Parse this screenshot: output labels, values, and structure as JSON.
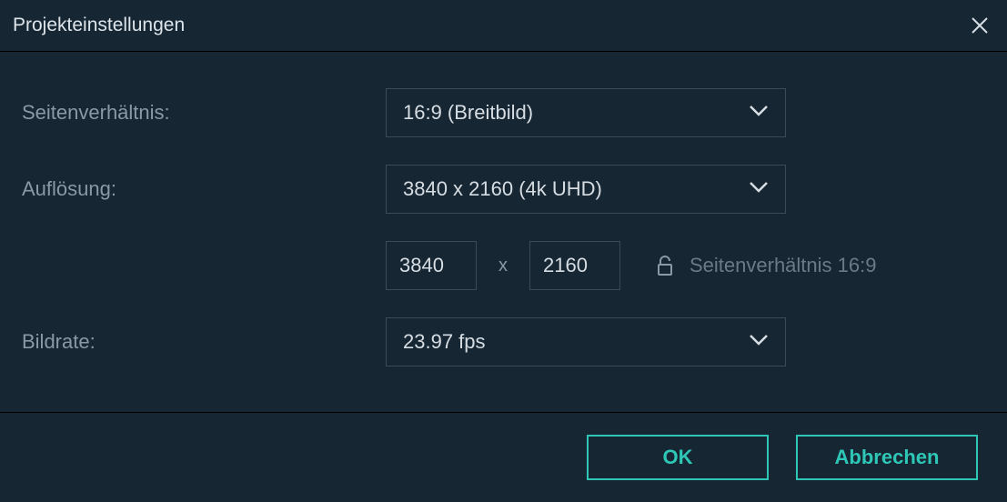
{
  "header": {
    "title": "Projekteinstellungen"
  },
  "form": {
    "aspect_ratio_label": "Seitenverhältnis:",
    "aspect_ratio_value": "16:9 (Breitbild)",
    "resolution_label": "Auflösung:",
    "resolution_value": "3840 x 2160 (4k UHD)",
    "width_value": "3840",
    "height_value": "2160",
    "x_separator": "x",
    "ratio_locked_text": "Seitenverhältnis 16:9",
    "framerate_label": "Bildrate:",
    "framerate_value": "23.97 fps"
  },
  "footer": {
    "ok_label": "OK",
    "cancel_label": "Abbrechen"
  }
}
